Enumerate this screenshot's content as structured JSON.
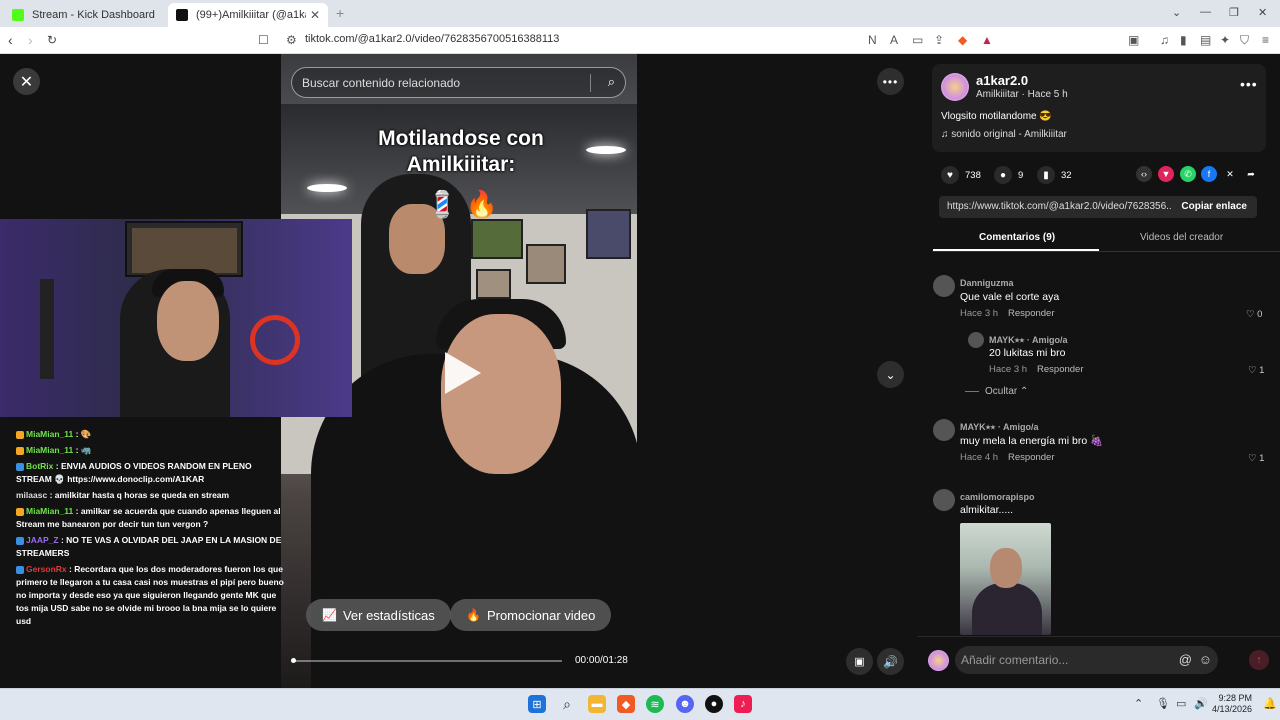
{
  "browser": {
    "tabs": [
      {
        "title": "Stream - Kick Dashboard",
        "favicon_color": "#53fc18"
      },
      {
        "title": "(99+)Amilkiiitar (@a1kar2.0) | TikTok",
        "favicon_color": "#111111"
      }
    ],
    "url": "tiktok.com/@a1kar2.0/video/7628356700516388113"
  },
  "video": {
    "search_placeholder": "Buscar contenido relacionado",
    "caption_line1": "Motilandose con",
    "caption_line2": "Amilkiiitar:",
    "caption_emoji": "💈 🔥",
    "stats_button": "Ver estadísticas",
    "promote_button": "Promocionar video",
    "time": "00:00/01:28",
    "progress": 0.0
  },
  "chat": [
    {
      "user": "MiaMian_11",
      "text": ": 🎨",
      "user_color": "#6fe34a",
      "badge": "#f5a623"
    },
    {
      "user": "MiaMian_11",
      "text": ": 🦏",
      "user_color": "#6fe34a",
      "badge": "#f5a623"
    },
    {
      "user": "BotRix",
      "text": ": ENVIA AUDIOS O VIDEOS RANDOM EN PLENO STREAM 💀 https://www.donoclip.com/A1KAR",
      "user_color": "#6fe34a",
      "badge": "#3a8fe0"
    },
    {
      "user": "milaasc",
      "text": ": amilkitar hasta q horas se queda en stream",
      "user_color": "#dddddd",
      "badge": ""
    },
    {
      "user": "MiaMian_11",
      "text": ": amilkar se acuerda que cuando apenas lleguen al Stream me banearon por decir tun tun vergon ?",
      "user_color": "#6fe34a",
      "badge": "#f5a623"
    },
    {
      "user": "JAAP_Z",
      "text": ": NO TE VAS A OLVIDAR DEL JAAP EN LA MASION DE STREAMERS",
      "user_color": "#9a6cf0",
      "badge": "#3a8fe0"
    },
    {
      "user": "GersonRx",
      "text": ": Recordara que los dos moderadores fueron los que primero te llegaron a tu casa casi nos muestras el pipí pero bueno no importa y desde eso ya que siguieron llegando gente MK que tos mija USD sabe no se olvide mi brooo la bna mija se lo quiere usd",
      "user_color": "#e03a3a",
      "badge": "#3a8fe0"
    }
  ],
  "post": {
    "author": "a1kar2.0",
    "subtitle": "Amilkiiitar · Hace 5 h",
    "description": "Vlogsito motilandome 😎",
    "sound": "sonido original - Amilkiiitar",
    "likes": "738",
    "comments": "9",
    "saves": "32",
    "link": "https://www.tiktok.com/@a1kar2.0/video/7628356...",
    "copy_label": "Copiar enlace",
    "tab_comments": "Comentarios (9)",
    "tab_creator": "Videos del creador",
    "hide_label": "Ocultar ⌃",
    "add_comment_placeholder": "Añadir comentario..."
  },
  "comments": [
    {
      "user": "Danniguzma",
      "text": "Que vale el corte aya",
      "time": "Hace 3 h",
      "reply": "Responder",
      "likes": "0"
    },
    {
      "user": "MAYK⭑⭑ · Amigo/a",
      "text": "20 lukitas mi bro",
      "time": "Hace 3 h",
      "reply": "Responder",
      "likes": "1"
    },
    {
      "user": "MAYK⭑⭑ · Amigo/a",
      "text": "muy mela la energía mi bro 🍇",
      "time": "Hace 4 h",
      "reply": "Responder",
      "likes": "1"
    },
    {
      "user": "camilomorapispo",
      "text": "almikitar.....",
      "time": "",
      "reply": "",
      "likes": ""
    }
  ],
  "taskbar": {
    "time": "9:28 PM",
    "date": "4/13/2026"
  }
}
